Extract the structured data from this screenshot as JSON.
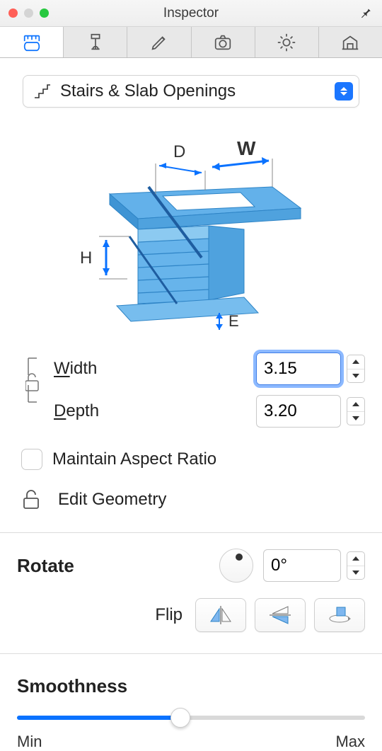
{
  "window": {
    "title": "Inspector"
  },
  "selector": {
    "label": "Stairs & Slab Openings"
  },
  "diagram_labels": {
    "D": "D",
    "W": "W",
    "H": "H",
    "E": "E"
  },
  "dims": {
    "width_label": "idth",
    "width_prefix": "W",
    "depth_label": "epth",
    "depth_prefix": "D",
    "width_value": "3.15",
    "depth_value": "3.20"
  },
  "maintain_label": "Maintain Aspect Ratio",
  "maintain_checked": false,
  "edit_geometry_label": "Edit Geometry",
  "rotate": {
    "label": "Rotate",
    "value": "0°"
  },
  "flip_label": "Flip",
  "smoothness": {
    "label": "Smoothness",
    "min": "Min",
    "max": "Max",
    "percent": 47
  }
}
